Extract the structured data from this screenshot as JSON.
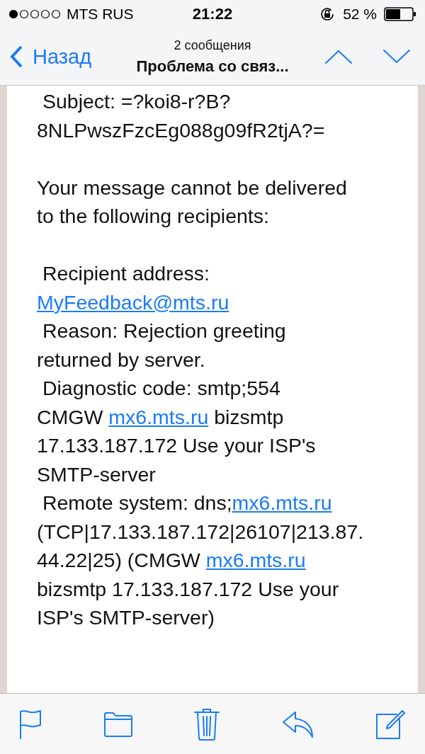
{
  "status_bar": {
    "carrier": "MTS RUS",
    "time": "21:22",
    "battery": "52 %"
  },
  "nav_bar": {
    "back": "Назад",
    "subtitle": "2 сообщения",
    "title": "Проблема со связ..."
  },
  "message": {
    "paragraphs": [
      [
        [
          {
            "text": " Subject: =?koi8-r?B?",
            "link": false
          }
        ],
        [
          {
            "text": "8NLPwszFzcEg088g09fR2tjA?=",
            "link": false
          }
        ]
      ],
      [
        [
          {
            "text": "Your message cannot be delivered",
            "link": false
          }
        ],
        [
          {
            "text": "to the following recipients:",
            "link": false
          }
        ]
      ],
      [
        [
          {
            "text": " Recipient address:",
            "link": false
          }
        ],
        [
          {
            "text": "MyFeedback@mts.ru",
            "link": true
          }
        ],
        [
          {
            "text": " Reason: Rejection greeting",
            "link": false
          }
        ],
        [
          {
            "text": "returned by server.",
            "link": false
          }
        ],
        [
          {
            "text": " Diagnostic code: smtp;554",
            "link": false
          }
        ],
        [
          {
            "text": "CMGW ",
            "link": false
          },
          {
            "text": "mx6.mts.ru",
            "link": true
          },
          {
            "text": " bizsmtp",
            "link": false
          }
        ],
        [
          {
            "text": "17.133.187.172 Use your ISP's",
            "link": false
          }
        ],
        [
          {
            "text": "SMTP-server",
            "link": false
          }
        ],
        [
          {
            "text": " Remote system: dns;",
            "link": false
          },
          {
            "text": "mx6.mts.ru",
            "link": true
          }
        ],
        [
          {
            "text": "(TCP|17.133.187.172|26107|213.87.",
            "link": false
          }
        ],
        [
          {
            "text": "44.22|25) (CMGW ",
            "link": false
          },
          {
            "text": "mx6.mts.ru",
            "link": true
          }
        ],
        [
          {
            "text": "bizsmtp 17.133.187.172 Use your",
            "link": false
          }
        ],
        [
          {
            "text": "ISP's SMTP-server)",
            "link": false
          }
        ]
      ]
    ]
  }
}
